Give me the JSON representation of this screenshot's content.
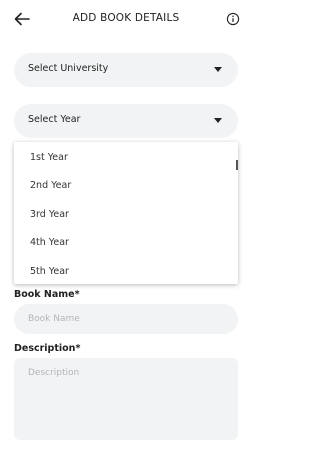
{
  "header": {
    "title": "ADD BOOK DETAILS",
    "back_icon": "arrow-left-icon",
    "info_icon": "info-circle-icon"
  },
  "university_select": {
    "label": "Select University"
  },
  "year_select": {
    "label": "Select Year"
  },
  "year_options": [
    "1st Year",
    "2nd Year",
    "3rd Year",
    "4th Year",
    "5th Year"
  ],
  "book_name": {
    "label": "Book Name*",
    "placeholder": "Book Name",
    "value": ""
  },
  "description": {
    "label": "Description*",
    "placeholder": "Description",
    "value": ""
  }
}
